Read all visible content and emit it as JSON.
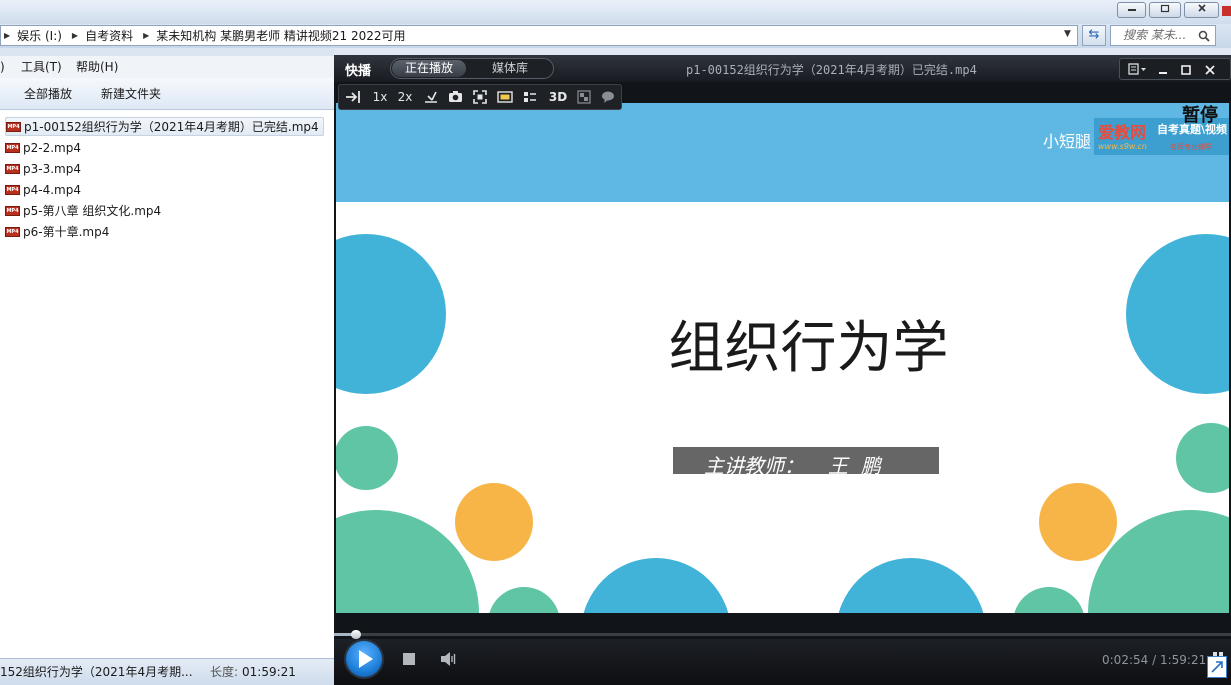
{
  "explorer": {
    "breadcrumbs": [
      "娱乐 (I:)",
      "自考资料",
      "某未知机构 某鹏男老师 精讲视频21  2022可用"
    ],
    "search_placeholder": "搜索 某未...",
    "menu": [
      ")",
      "工具(T)",
      "帮助(H)"
    ],
    "toolbar": [
      "全部播放",
      "新建文件夹"
    ],
    "files": [
      "p1-00152组织行为学（2021年4月考期）已完结.mp4",
      "p2-2.mp4",
      "p3-3.mp4",
      "p4-4.mp4",
      "p5-第八章 组织文化.mp4",
      "p6-第十章.mp4"
    ],
    "file_icon_text": "MP4",
    "status": {
      "name": "152组织行为学（2021年4月考期...",
      "length_label": "长度:",
      "length_value": "01:59:21"
    }
  },
  "player": {
    "brand": "快播",
    "tabs": [
      "正在播放",
      "媒体库"
    ],
    "title": "p1-00152组织行为学（2021年4月考期）已完结.mp4",
    "tools": {
      "speed1": "1x",
      "speed2": "2x",
      "mode3d": "3D"
    },
    "overlay": {
      "paused": "暂停",
      "watermark_left": "小短腿",
      "logo": "爱教网",
      "logo_url": "www.s9w.cn",
      "logo_tag": "自考真题\\视频",
      "logo_small": "名师专业辅导"
    },
    "slide": {
      "title": "组织行为学",
      "teacher_label": "主讲教师：",
      "teacher_name": "王  鹏"
    },
    "time": {
      "current": "0:02:54",
      "separator": "/",
      "total": "1:59:21"
    },
    "progress": 0.024,
    "colors": {
      "slide_header": "#5fb8e4",
      "circle_blue": "#41b2d8",
      "circle_green": "#5fc5a5",
      "circle_orange": "#f7b548",
      "play_button": "#1e7fd8"
    }
  }
}
